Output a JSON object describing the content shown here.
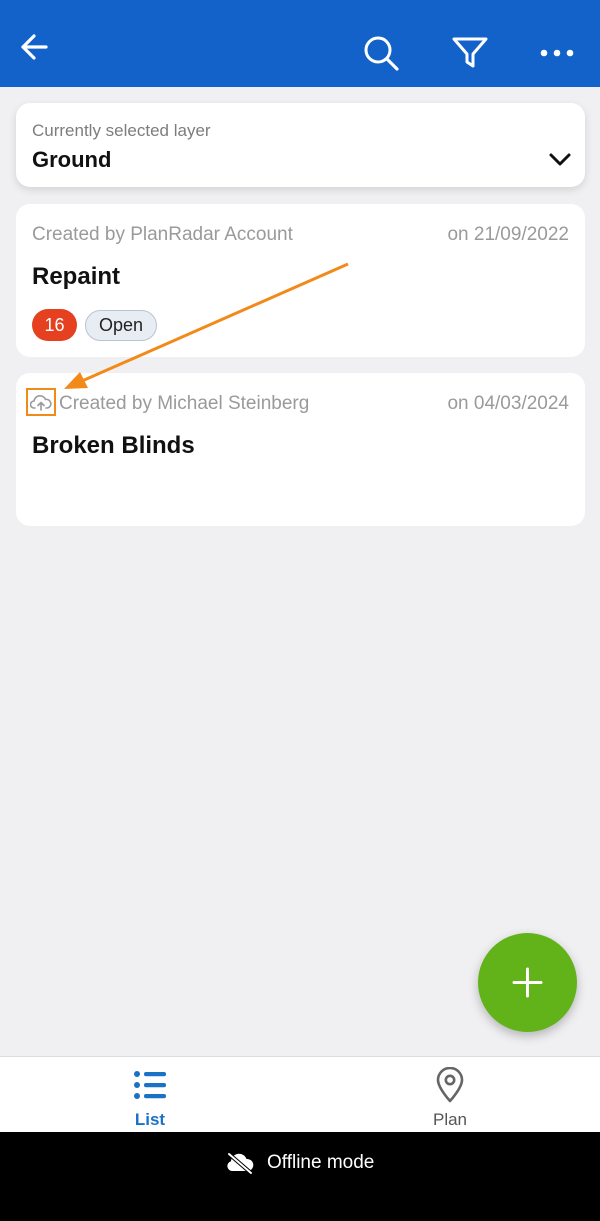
{
  "header": {
    "icons": [
      "back-arrow-icon",
      "search-icon",
      "filter-icon",
      "more-icon"
    ],
    "background": "#1262c9"
  },
  "layer": {
    "caption": "Currently selected layer",
    "value": "Ground"
  },
  "tickets": [
    {
      "created_by": "Created by PlanRadar Account",
      "date": "on 21/09/2022",
      "title": "Repaint",
      "number": "16",
      "status": "Open",
      "number_color": "#e5401f"
    },
    {
      "created_by": "Created by Michael Steinberg",
      "date": "on 04/03/2024",
      "title": "Broken Blinds",
      "icon": "cloud-upload-icon"
    }
  ],
  "annotation": {
    "color": "#f28a1a"
  },
  "fab": {
    "icon": "plus-icon",
    "color": "#62b31a"
  },
  "bottom_nav": {
    "items": [
      {
        "label": "List",
        "icon": "list-icon",
        "active": true
      },
      {
        "label": "Plan",
        "icon": "location-pin-icon",
        "active": false
      }
    ],
    "active_color": "#1a72c4"
  },
  "offline_bar": {
    "label": "Offline mode",
    "icon": "cloud-off-icon"
  }
}
